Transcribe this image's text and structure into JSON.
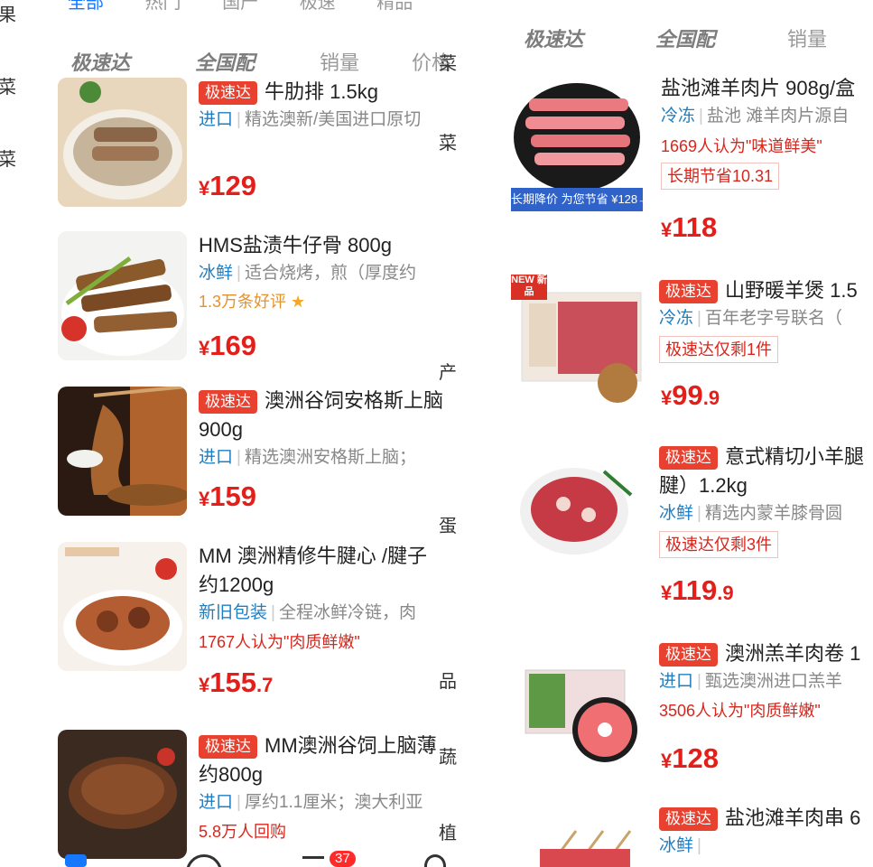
{
  "left_panel": {
    "side_categories": [
      "果",
      "菜",
      "菜",
      "产",
      "蛋",
      "品",
      "蔬",
      "植"
    ],
    "top_tabs": [
      "全部",
      "热门",
      "国产",
      "极速",
      "精品"
    ],
    "subtabs": [
      "极速达",
      "全国配",
      "销量",
      "价格"
    ],
    "products": [
      {
        "badge": "极速达",
        "title": "牛肋排 1.5kg",
        "title_line2": "",
        "tag": "进口",
        "desc": "精选澳新/美国进口原切",
        "highlight": "",
        "price_int": "129",
        "price_dec": ""
      },
      {
        "badge": "",
        "title": "HMS盐渍牛仔骨 800g",
        "title_line2": "",
        "tag": "冰鲜",
        "desc": "适合烧烤，煎（厚度约",
        "highlight": "1.3万条好评",
        "price_int": "169",
        "price_dec": ""
      },
      {
        "badge": "极速达",
        "title": "澳洲谷饲安格斯上脑",
        "title_line2": "900g",
        "tag": "进口",
        "desc": "精选澳洲安格斯上脑；",
        "highlight": "",
        "price_int": "159",
        "price_dec": ""
      },
      {
        "badge": "",
        "title": "MM 澳洲精修牛腱心 /腱子",
        "title_line2": "约1200g",
        "tag": "新旧包装",
        "desc": "全程冰鲜冷链，肉",
        "highlight": "1767人认为\"肉质鲜嫩\"",
        "price_int": "155",
        "price_dec": ".7"
      },
      {
        "badge": "极速达",
        "title": "MM澳洲谷饲上脑薄",
        "title_line2": "约800g",
        "tag": "进口",
        "desc": "厚约1.1厘米；澳大利亚",
        "highlight": "5.8万人回购",
        "price_int": "",
        "price_dec": ""
      }
    ],
    "cart_count": "37"
  },
  "right_panel": {
    "subtabs": [
      "极速达",
      "全国配",
      "销量"
    ],
    "products": [
      {
        "badge": "",
        "title": "盐池滩羊肉片 908g/盒",
        "title_line2": "",
        "tag": "冷冻",
        "desc": "盐池 滩羊肉片源自",
        "highlight": "1669人认为\"味道鲜美\"",
        "highlight2": "长期节省10.31",
        "price_int": "118",
        "price_dec": "",
        "img_banner": "长期降价 为您节省 ¥128→¥118"
      },
      {
        "badge": "极速达",
        "title": "山野暖羊煲 1.5",
        "title_line2": "",
        "tag": "冷冻",
        "desc": "百年老字号联名（",
        "highlight": "极速达仅剩1件",
        "highlight2": "",
        "price_int": "99",
        "price_dec": ".9",
        "img_banner": "NEW 新品"
      },
      {
        "badge": "极速达",
        "title": "意式精切小羊腿",
        "title_line2": "腱）1.2kg",
        "tag": "冰鲜",
        "desc": "精选内蒙羊膝骨圆",
        "highlight": "极速达仅剩3件",
        "highlight2": "",
        "price_int": "119",
        "price_dec": ".9",
        "img_banner": ""
      },
      {
        "badge": "极速达",
        "title": "澳洲羔羊肉卷 1",
        "title_line2": "",
        "tag": "进口",
        "desc": "甄选澳洲进口羔羊",
        "highlight": "3506人认为\"肉质鲜嫩\"",
        "highlight2": "",
        "price_int": "128",
        "price_dec": "",
        "img_banner": ""
      },
      {
        "badge": "极速达",
        "title": "盐池滩羊肉串 6",
        "title_line2": "",
        "tag": "冰鲜",
        "desc": "",
        "highlight": "",
        "highlight2": "",
        "price_int": "",
        "price_dec": "",
        "img_banner": ""
      }
    ]
  },
  "colors": {
    "price": "#e41f19",
    "badge": "#e8412f",
    "tag": "#1f7ec2",
    "gold": "#e5922b"
  }
}
